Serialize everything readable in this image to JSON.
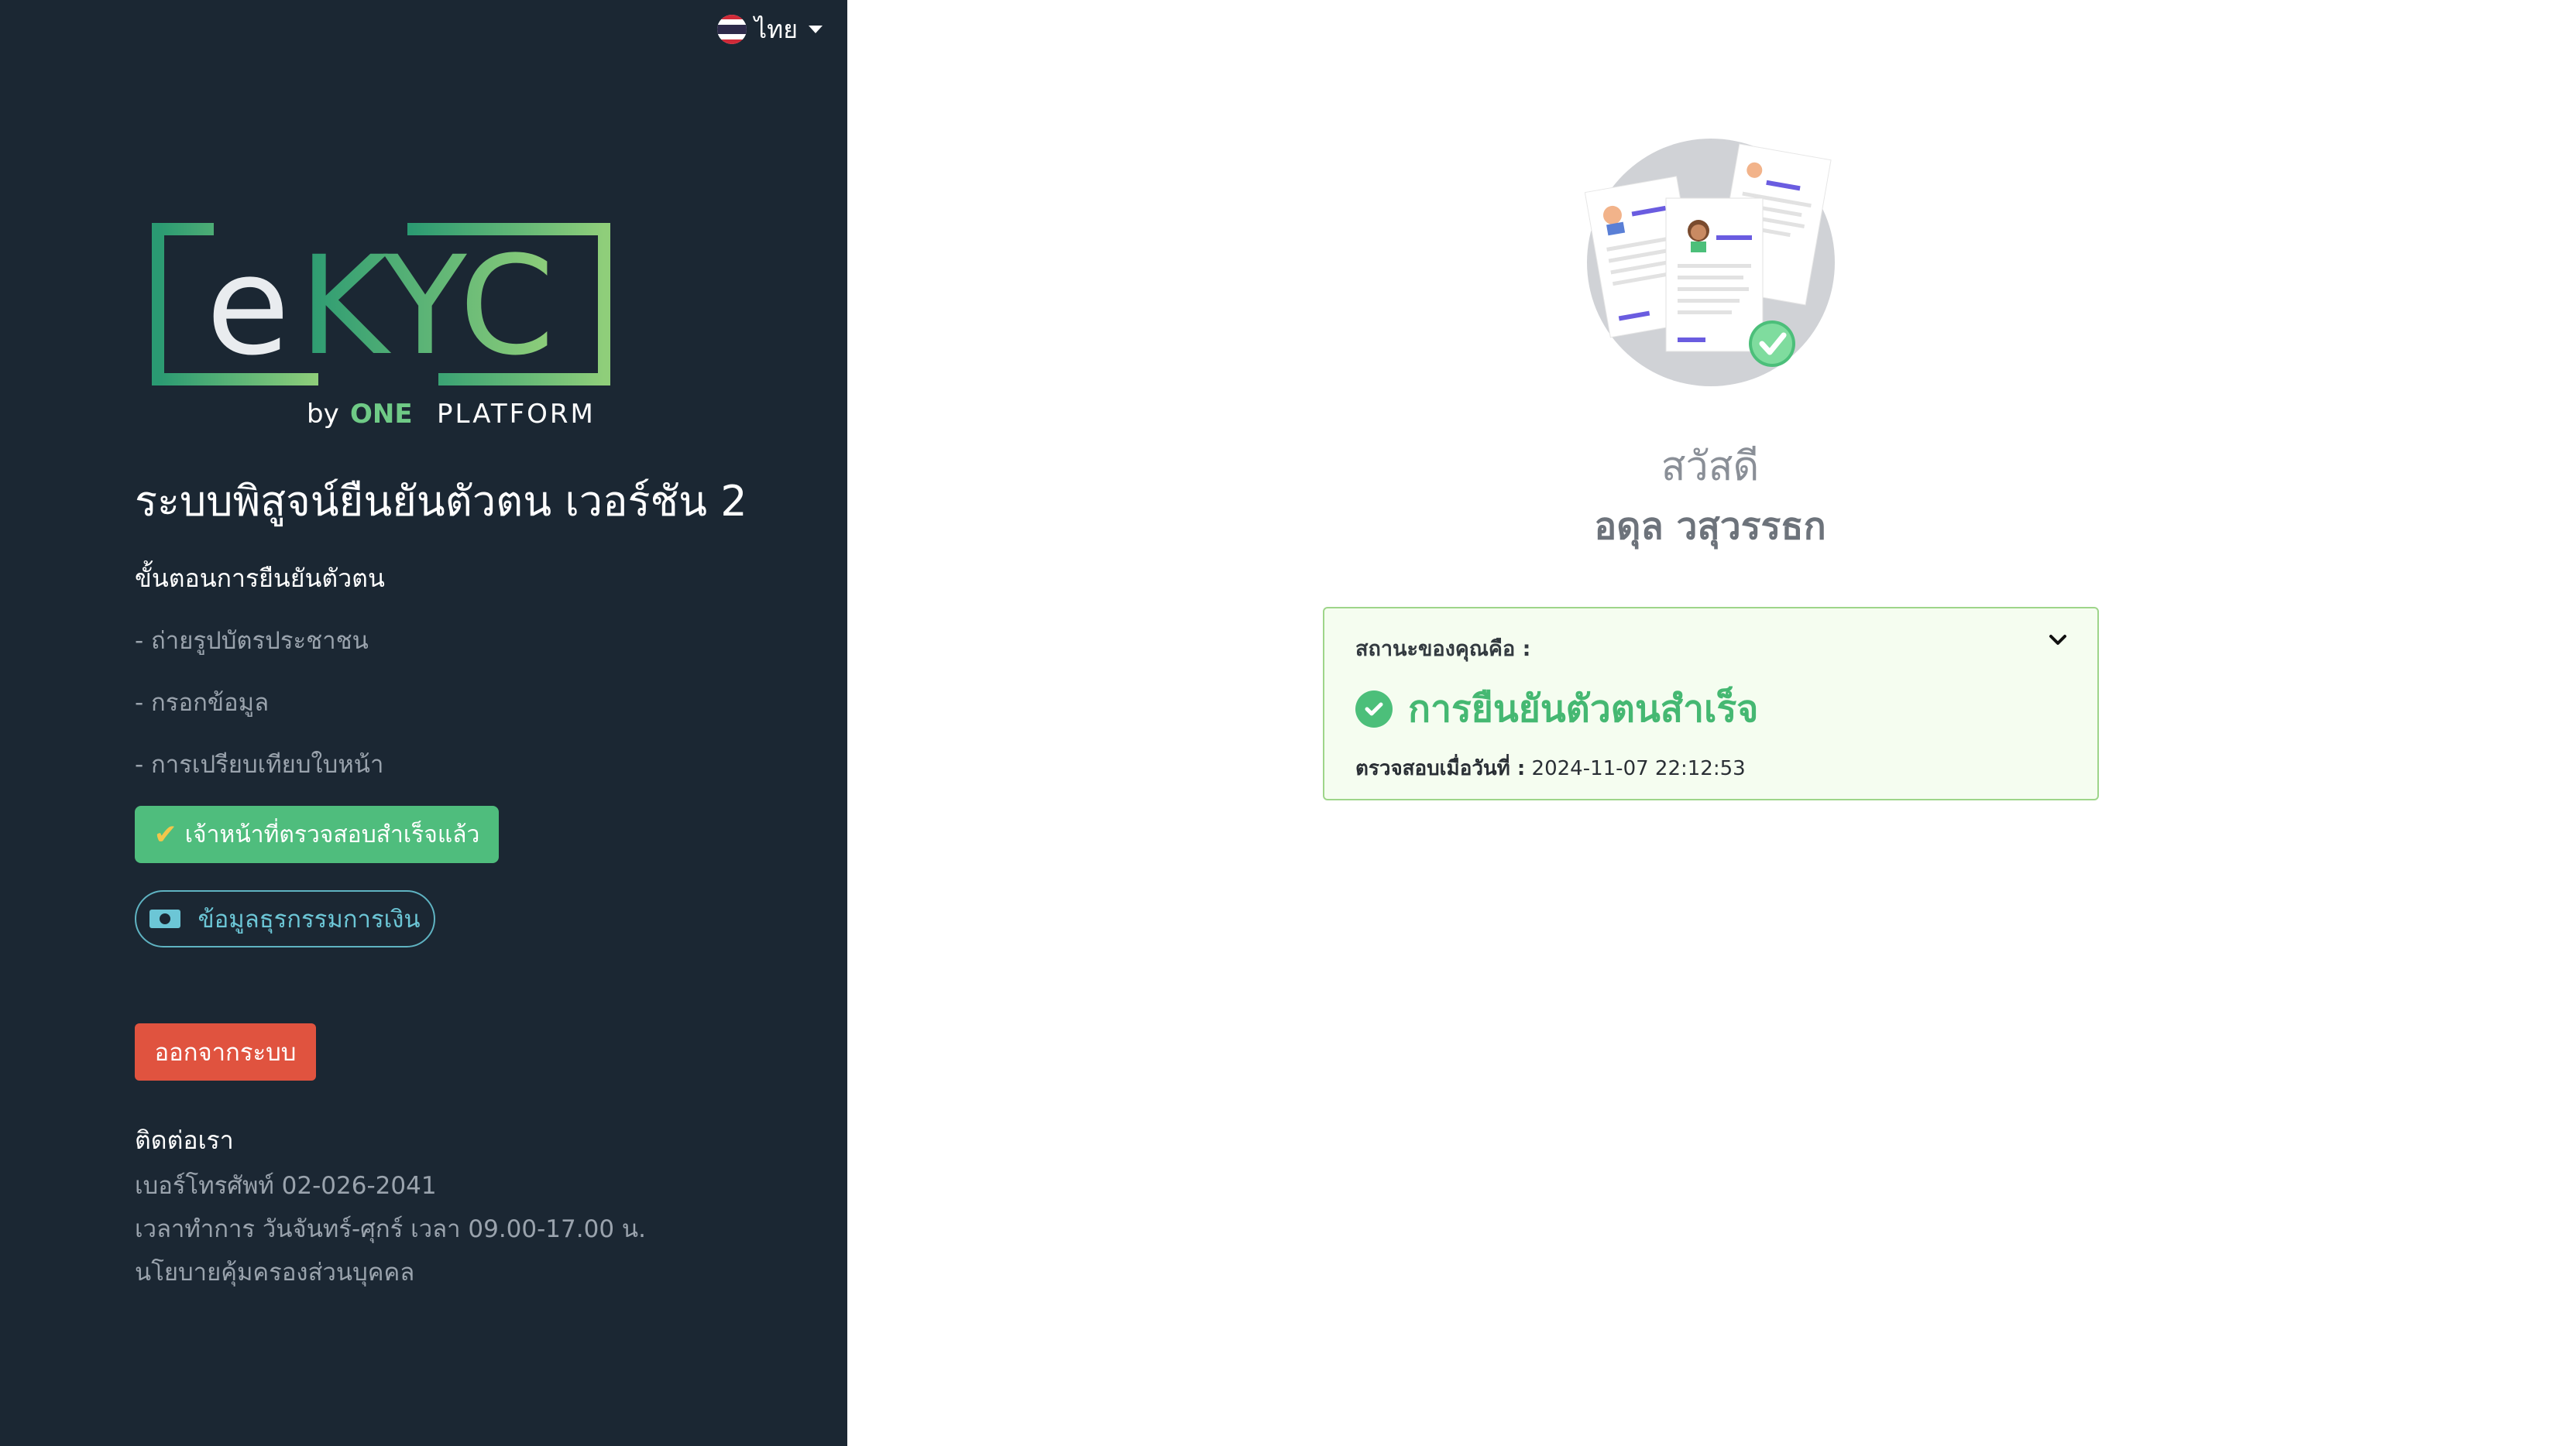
{
  "language": {
    "label": "ไทย",
    "flag": "thai-flag"
  },
  "logo": {
    "main": "eKYC",
    "sub": "by ONE PLATFORM"
  },
  "sidebar": {
    "title": "ระบบพิสูจน์ยืนยันตัวตน เวอร์ชัน 2",
    "steps_heading": "ขั้นตอนการยืนยันตัวตน",
    "steps": [
      "- ถ่ายรูปบัตรประชาชน",
      "- กรอกข้อมูล",
      "- การเปรียบเทียบใบหน้า"
    ],
    "verified_badge": "เจ้าหน้าที่ตรวจสอบสำเร็จแล้ว",
    "finance_button": "ข้อมูลธุรกรรมการเงิน",
    "logout_button": "ออกจากระบบ",
    "contact": {
      "heading": "ติดต่อเรา",
      "phone": "เบอร์โทรศัพท์ 02-026-2041",
      "hours": "เวลาทำการ วันจันทร์-ศุกร์ เวลา 09.00-17.00 น.",
      "privacy": "นโยบายคุ้มครองส่วนบุคคล"
    }
  },
  "main": {
    "greeting": "สวัสดี",
    "username": "อดุล วสุวรรธก",
    "status_card": {
      "label": "สถานะของคุณคือ :",
      "status": "การยืนยันตัวตนสำเร็จ",
      "checked_label": "ตรวจสอบเมื่อวันที่ :",
      "checked_value": "2024-11-07 22:12:53"
    }
  },
  "colors": {
    "sidebar_bg": "#1b2733",
    "success_green": "#4cbf7a",
    "logout_red": "#e0533f",
    "finance_teal": "#6cc6d6",
    "card_border": "#9ed58a"
  }
}
